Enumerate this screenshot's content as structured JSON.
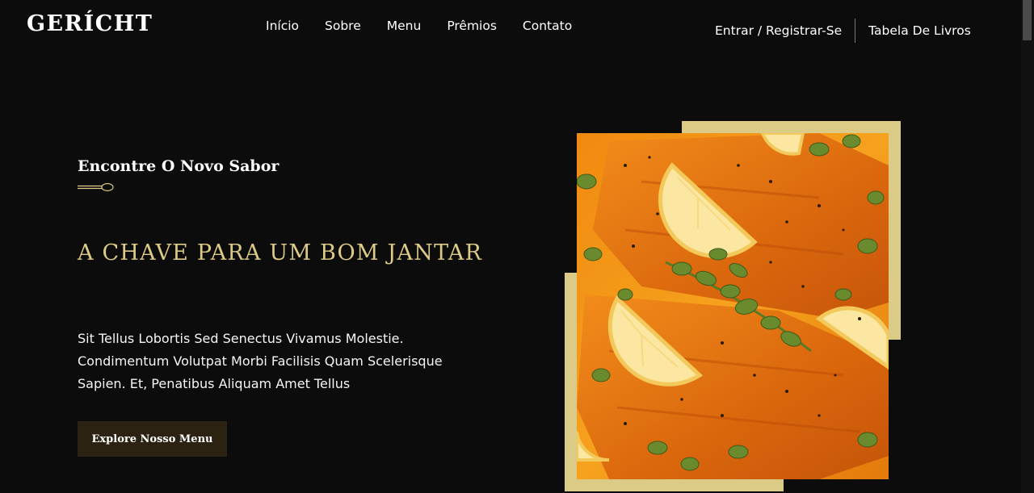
{
  "brand": {
    "logo": "GERÍCHT"
  },
  "nav": {
    "links": [
      "Início",
      "Sobre",
      "Menu",
      "Prêmios",
      "Contato"
    ],
    "login": "Entrar / Registrar-Se",
    "book_table": "Tabela De Livros"
  },
  "hero": {
    "subtitle": "Encontre O Novo Sabor",
    "title": "A CHAVE PARA UM BOM JANTAR",
    "description": "Sit Tellus Lobortis Sed Senectus Vivamus Molestie. Condimentum Volutpat Morbi Facilisis Quam Scelerisque Sapien. Et, Penatibus Aliquam Amet Tellus",
    "button_label": "Explore Nosso Menu",
    "image_icon": "salmon-dish-image"
  },
  "colors": {
    "background": "#0c0c0c",
    "accent_gold": "#dcca87",
    "button_bg": "#2b2211",
    "text": "#ffffff"
  }
}
